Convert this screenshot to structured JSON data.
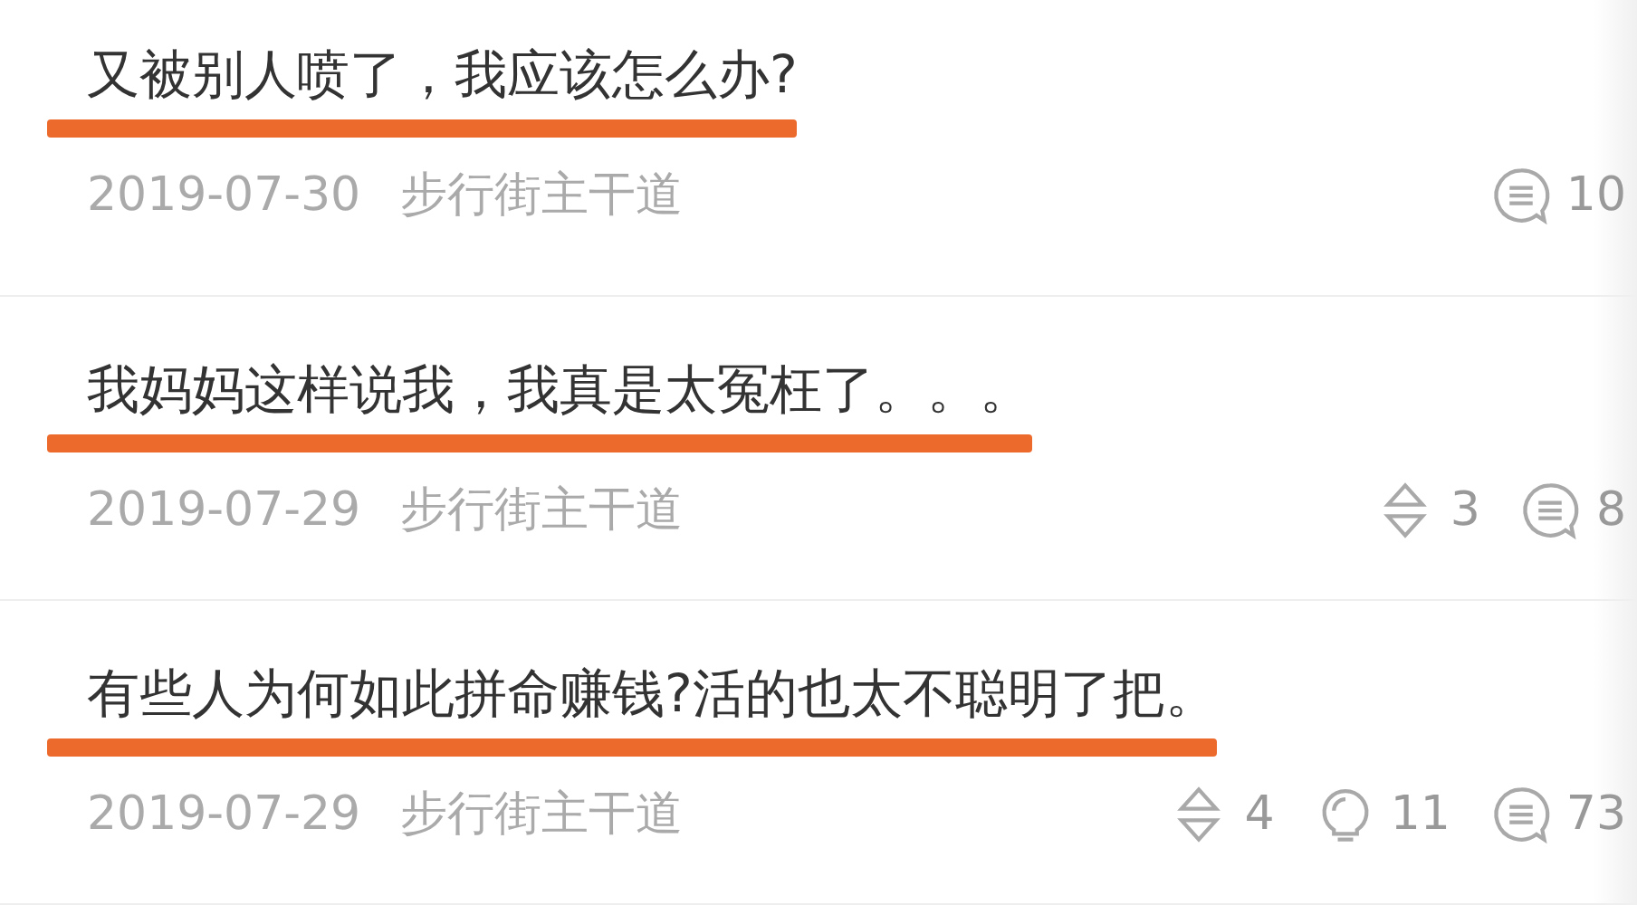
{
  "posts": [
    {
      "title": "又被别人喷了，我应该怎么办?",
      "date": "2019-07-30",
      "board": "步行街主干道",
      "stats": [
        {
          "kind": "comments",
          "value": "10"
        }
      ]
    },
    {
      "title": "我妈妈这样说我，我真是太冤枉了。。。",
      "date": "2019-07-29",
      "board": "步行街主干道",
      "stats": [
        {
          "kind": "votes",
          "value": "3"
        },
        {
          "kind": "comments",
          "value": "8"
        }
      ]
    },
    {
      "title": "有些人为何如此拼命赚钱?活的也太不聪明了把。",
      "date": "2019-07-29",
      "board": "步行街主干道",
      "stats": [
        {
          "kind": "votes",
          "value": "4"
        },
        {
          "kind": "likes",
          "value": "11"
        },
        {
          "kind": "comments",
          "value": "73"
        }
      ]
    }
  ]
}
